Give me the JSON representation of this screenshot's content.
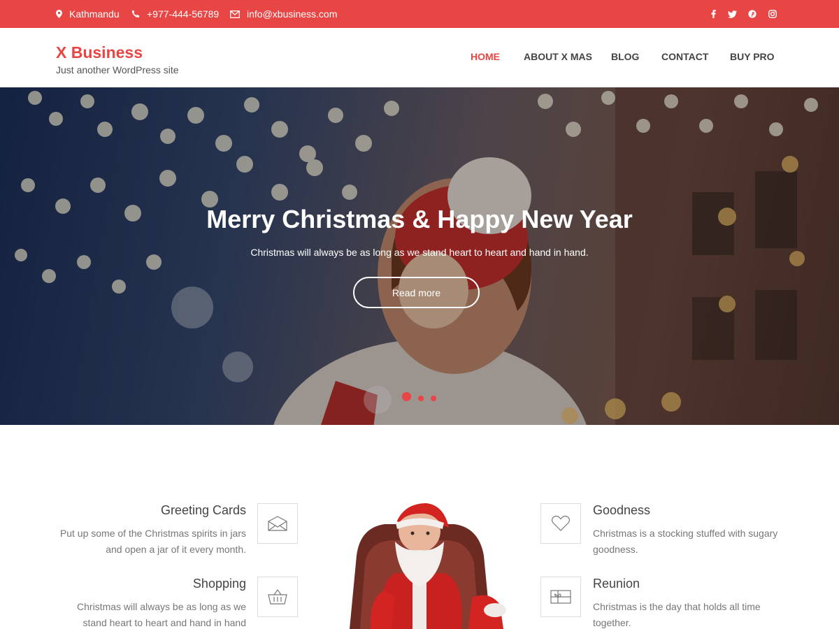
{
  "topbar": {
    "location": "Kathmandu",
    "phone": "+977-444-56789",
    "email": "info@xbusiness.com",
    "social": [
      "facebook-icon",
      "twitter-icon",
      "pinterest-icon",
      "instagram-icon"
    ]
  },
  "header": {
    "site_title": "X Business",
    "tagline": "Just another WordPress site"
  },
  "nav": {
    "home": "HOME",
    "about": "ABOUT X MAS",
    "blog": "BLOG",
    "contact": "CONTACT",
    "buy_pro": "BUY PRO"
  },
  "hero": {
    "title": "Merry Christmas & Happy New Year",
    "subtitle": "Christmas will always be as long as we stand heart to heart and hand in hand.",
    "button": "Read more",
    "slides": 3,
    "active_slide": 1
  },
  "features": {
    "left": [
      {
        "title": "Greeting Cards",
        "text_line1": "Put up some of the Christmas spirits in jars",
        "text_line2": "and open a jar of it every month.",
        "icon": "envelope-icon"
      },
      {
        "title": "Shopping",
        "text_line1": "Christmas will always be as long as we",
        "text_line2": "stand heart to heart and hand in hand",
        "icon": "basket-icon"
      }
    ],
    "right": [
      {
        "title": "Goodness",
        "text_line1": "Christmas is a stocking stuffed with sugary",
        "text_line2": "goodness.",
        "icon": "heart-icon"
      },
      {
        "title": "Reunion",
        "text_line1": "Christmas is the day that holds all time",
        "text_line2": "together.",
        "icon": "gift-icon"
      }
    ],
    "center_image": "santa-claus-image"
  },
  "colors": {
    "accent": "#e84545",
    "text_dark": "#444444",
    "text_muted": "#777777",
    "border": "#dddddd"
  }
}
